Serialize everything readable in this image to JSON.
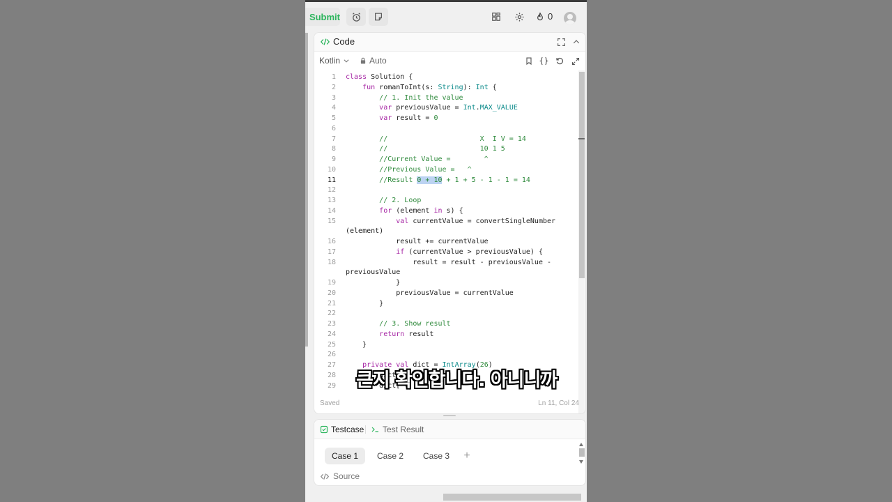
{
  "topbar": {
    "submit_label": "Submit",
    "fire_count": "0"
  },
  "code_panel": {
    "title": "Code",
    "language": "Kotlin",
    "mode": "Auto",
    "status_saved": "Saved",
    "cursor_position": "Ln 11, Col 24"
  },
  "editor": {
    "active_line": 11,
    "lines": [
      {
        "n": "1",
        "text": "class Solution {"
      },
      {
        "n": "2",
        "text": "    fun romanToInt(s: String): Int {"
      },
      {
        "n": "3",
        "text": "        // 1. Init the value"
      },
      {
        "n": "4",
        "text": "        var previousValue = Int.MAX_VALUE"
      },
      {
        "n": "5",
        "text": "        var result = 0"
      },
      {
        "n": "6",
        "text": ""
      },
      {
        "n": "7",
        "text": "        //                      X  I V = 14"
      },
      {
        "n": "8",
        "text": "        //                      10 1 5"
      },
      {
        "n": "9",
        "text": "        //Current Value =        ^"
      },
      {
        "n": "10",
        "text": "        //Previous Value =   ^"
      },
      {
        "n": "11",
        "text": "        //Result 0 + 10 + 1 + 5 - 1 - 1 = 14"
      },
      {
        "n": "12",
        "text": ""
      },
      {
        "n": "13",
        "text": "        // 2. Loop"
      },
      {
        "n": "14",
        "text": "        for (element in s) {"
      },
      {
        "n": "15",
        "text": "            val currentValue = convertSingleNumber"
      },
      {
        "n": "",
        "text": "(element)"
      },
      {
        "n": "16",
        "text": "            result += currentValue"
      },
      {
        "n": "17",
        "text": "            if (currentValue > previousValue) {"
      },
      {
        "n": "18",
        "text": "                result = result - previousValue -"
      },
      {
        "n": "",
        "text": "previousValue"
      },
      {
        "n": "19",
        "text": "            }"
      },
      {
        "n": "20",
        "text": "            previousValue = currentValue"
      },
      {
        "n": "21",
        "text": "        }"
      },
      {
        "n": "22",
        "text": ""
      },
      {
        "n": "23",
        "text": "        // 3. Show result"
      },
      {
        "n": "24",
        "text": "        return result"
      },
      {
        "n": "25",
        "text": "    }"
      },
      {
        "n": "26",
        "text": ""
      },
      {
        "n": "27",
        "text": "    private val dict = IntArray(26)"
      },
      {
        "n": "28",
        "text": "        dict['I'"
      },
      {
        "n": "29",
        "text": "        dict['V'"
      }
    ]
  },
  "subtitle": "큰지 확인합니다. 아니니까",
  "test_panel": {
    "tab_testcase": "Testcase",
    "tab_result": "Test Result",
    "cases": [
      "Case 1",
      "Case 2",
      "Case 3"
    ],
    "add_label": "+",
    "source_label": "Source"
  },
  "colors": {
    "accent_green": "#2cb55d",
    "keyword": "#a626a4",
    "type": "#0b8a8a",
    "comment": "#2f8a3c",
    "selection": "#bcd3f2"
  }
}
